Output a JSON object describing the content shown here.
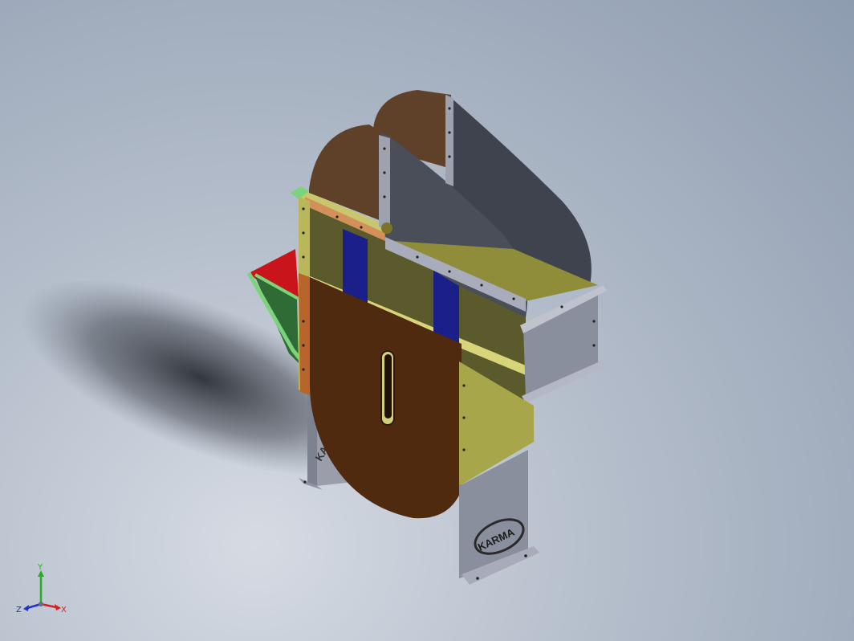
{
  "viewport": {
    "background_top": "#8e9cb0",
    "background_bottom": "#d6dbe3"
  },
  "model": {
    "logo_text": "KARMA",
    "colors": {
      "brown_plate": "#4f2a0e",
      "brown_curved": "#5e4128",
      "olive_panel": "#5b5a2c",
      "yellow_panel": "#a8a64a",
      "blue_stiffener": "#1b1f8a",
      "grey_steel": "#8a8f9e",
      "dark_steel": "#3f434e",
      "red_panel": "#c8141a",
      "green_panel": "#2f6b35",
      "light_green_frame": "#7bd47a"
    }
  },
  "triad": {
    "x_label": "X",
    "y_label": "Y",
    "z_label": "Z",
    "colors": {
      "x": "#d42020",
      "y": "#20b020",
      "z": "#2030c8"
    }
  }
}
